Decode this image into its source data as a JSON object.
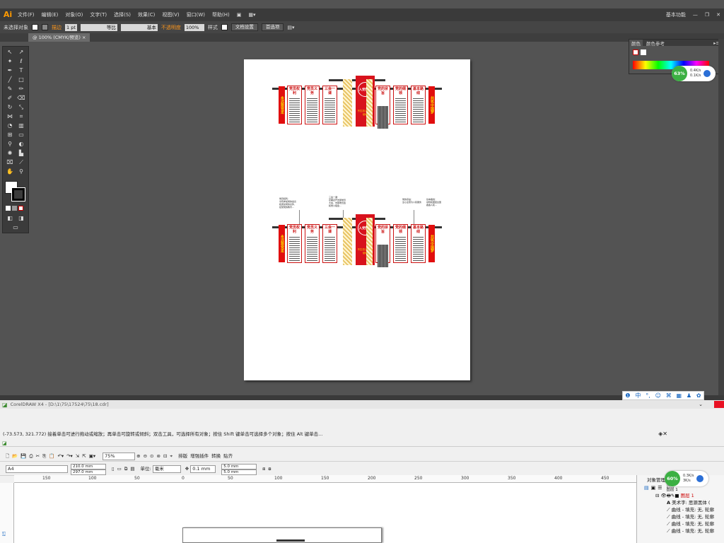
{
  "illustrator": {
    "logo": "Ai",
    "menu": [
      "文件(F)",
      "编辑(E)",
      "对象(O)",
      "文字(T)",
      "选择(S)",
      "效果(C)",
      "视图(V)",
      "窗口(W)",
      "帮助(H)"
    ],
    "workspace": "基本功能",
    "options": {
      "selection": "未选择对象",
      "stroke_label": "描边",
      "stroke_weight": "1 pt",
      "profile": "等比",
      "brush": "基本",
      "opacity_label": "不透明度",
      "opacity": "100%",
      "style_label": "样式",
      "doc_setup": "文档设置",
      "prefs": "首选项"
    },
    "doc_tab": "@ 100% (CMYK/预览)",
    "panel_tabs": [
      "颜色",
      "颜色参考"
    ],
    "artboard": {
      "panels_left": [
        "党员权利",
        "党员义务"
      ],
      "panels_mid": [
        "三会一课"
      ],
      "panels_right": [
        "党的宗旨",
        "党的纲领",
        "基本路线"
      ],
      "side_left": "永远跟党走",
      "side_right": "共筑中国梦",
      "emblem": "入党誓词",
      "center_sub": "不忘初心 牢记使命",
      "notes": [
        "党员权利：\n享有参加党的会议\n和阅读党的文件、\n接受党的教育…",
        "三会一课：\n定期召开支部党员\n大会、支部委员会\n和党小组会…",
        "党的宗旨：\n全心全意为人民服务",
        "基本路线：\n领导和团结全国\n各族人民…"
      ]
    },
    "ime": [
      "中",
      "°,",
      "☺",
      "⌘",
      "▦",
      "♟",
      "✿"
    ]
  },
  "speed_widgets": [
    {
      "percent": "63%",
      "up": "0.4K/s",
      "down": "0.1K/s"
    },
    {
      "percent": "60%",
      "up": "0.3K/s",
      "down": "3K/s"
    }
  ],
  "coreldraw": {
    "title": "CorelDRAW X4 - [D:\\1\\75\\17524\\75\\18.cdr]",
    "status": "(-73.573, 321.772)  接着单击可进行拖动或缩放；再单击可旋转或倾斜；双击工具，可选择所有对象；按住 Shift 键单击可选择多个对象；按住 Alt 键单击...",
    "zoom": "75%",
    "toolbar_labels": [
      "排版",
      "增强插件",
      "转换",
      "贴齐"
    ],
    "page_size": "A4",
    "width": "210.0 mm",
    "height": "297.0 mm",
    "unit_label": "单位:",
    "unit": "毫米",
    "nudge": "0.1 mm",
    "dup_x": "5.0 mm",
    "dup_y": "5.0 mm",
    "ruler_ticks": [
      "150",
      "100",
      "50",
      "0",
      "50",
      "100",
      "150",
      "200",
      "250",
      "300",
      "350",
      "400",
      "450"
    ],
    "object_manager": {
      "title": "对象管理器",
      "page": "页面 1",
      "layer_head": "图层 1",
      "layer": "图层 1",
      "items": [
        "美术字: 思源黑体 (",
        "曲线 - 填充: 无, 轮廓",
        "曲线 - 填充: 无, 轮廓",
        "曲线 - 填充: 无, 轮廓",
        "曲线 - 填充: 无, 轮廓"
      ]
    }
  }
}
